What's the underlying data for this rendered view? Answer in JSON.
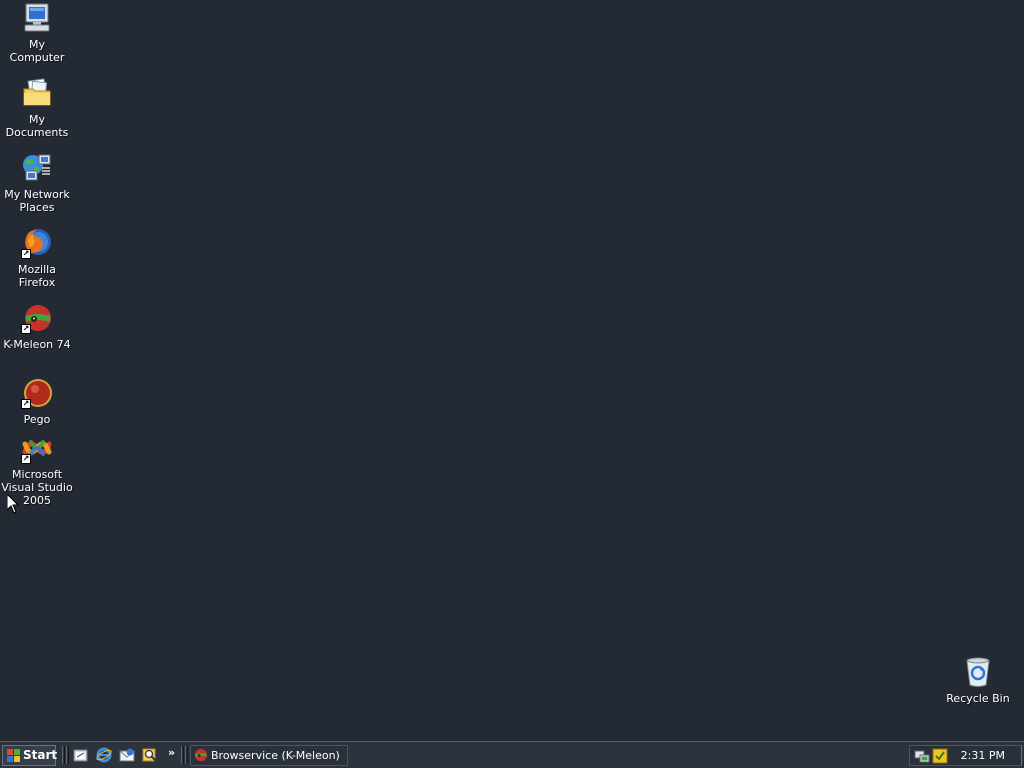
{
  "desktop": {
    "background_color": "#232a33",
    "icons": [
      {
        "label": "My Computer",
        "icon": "computer-icon"
      },
      {
        "label": "My Documents",
        "icon": "documents-folder-icon"
      },
      {
        "label": "My Network\nPlaces",
        "icon": "network-places-icon"
      },
      {
        "label": "Mozilla Firefox",
        "icon": "firefox-icon",
        "shortcut": true
      },
      {
        "label": "K-Meleon 74",
        "icon": "kmeleon-icon",
        "shortcut": true
      },
      {
        "label": "Pego",
        "icon": "pego-icon",
        "shortcut": true
      },
      {
        "label": "Microsoft\nVisual Studio\n2005",
        "icon": "visual-studio-icon",
        "shortcut": true
      }
    ],
    "recycle_bin": {
      "label": "Recycle Bin",
      "icon": "recycle-bin-icon"
    }
  },
  "taskbar": {
    "start_label": "Start",
    "quick_launch": [
      {
        "icon": "show-desktop-icon"
      },
      {
        "icon": "internet-explorer-icon"
      },
      {
        "icon": "outlook-express-icon"
      },
      {
        "icon": "search-icon"
      }
    ],
    "quick_launch_more": "»",
    "tasks": [
      {
        "label": "Browservice (K-Meleon)",
        "icon": "kmeleon-icon"
      }
    ],
    "tray": {
      "icons": [
        "network-tray-icon",
        "security-tray-icon"
      ],
      "clock": "2:31 PM"
    }
  }
}
